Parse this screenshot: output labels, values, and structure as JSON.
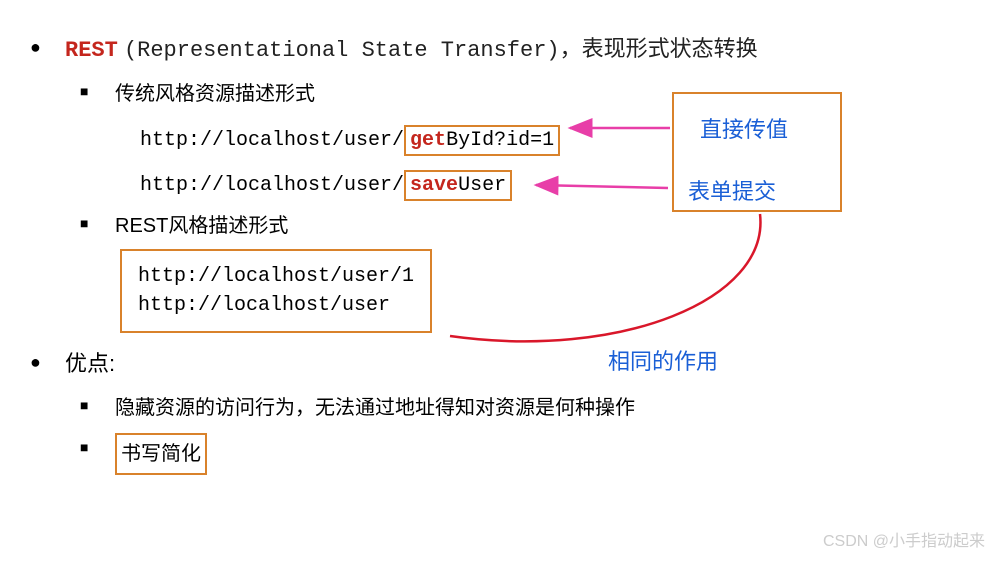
{
  "title_rest": "REST",
  "title_full": "(Representational State Transfer)，表现形式状态转换",
  "section_traditional": "传统风格资源描述形式",
  "url_get_prefix": "http://localhost/user/",
  "url_get_verb": "get",
  "url_get_suffix": "ById?id=1",
  "url_save_prefix": "http://localhost/user/",
  "url_save_verb": "save",
  "url_save_suffix": "User",
  "annot_direct": "直接传值",
  "annot_form": "表单提交",
  "section_rest": "REST风格描述形式",
  "rest_url_1": "http://localhost/user/1",
  "rest_url_2": "http://localhost/user",
  "annot_same": "相同的作用",
  "advantages_title": "优点:",
  "adv_1": "隐藏资源的访问行为，无法通过地址得知对资源是何种操作",
  "adv_2": "书写简化",
  "watermark": "CSDN @小手指动起来"
}
